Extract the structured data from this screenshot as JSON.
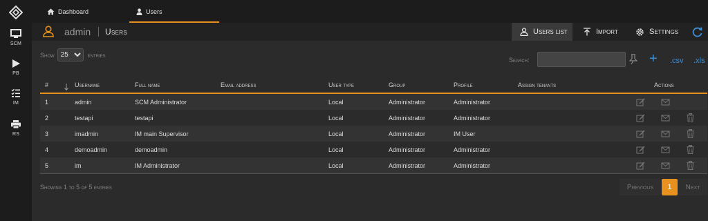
{
  "sidebar": {
    "items": [
      {
        "label": "SCM",
        "icon": "monitor-icon"
      },
      {
        "label": "PB",
        "icon": "play-icon"
      },
      {
        "label": "IM",
        "icon": "list-check-icon"
      },
      {
        "label": "RS",
        "icon": "printer-icon"
      }
    ]
  },
  "tabs": [
    {
      "label": "Dashboard",
      "icon": "home-icon"
    },
    {
      "label": "Users",
      "icon": "user-icon",
      "active": true
    }
  ],
  "header": {
    "username": "admin",
    "title": "Users",
    "buttons": {
      "users_list": "Users list",
      "import": "Import",
      "settings": "Settings"
    }
  },
  "controls": {
    "show_label": "Show",
    "show_value": "25",
    "entries_label": "entries",
    "search_label": "Search:",
    "search_value": "",
    "add_symbol": "+",
    "csv": ".csv",
    "xls": ".xls"
  },
  "table": {
    "columns": [
      "#",
      "Username",
      "Full name",
      "Email address",
      "User type",
      "Group",
      "Profile",
      "Assign tenants",
      "Actions"
    ],
    "rows": [
      {
        "num": "1",
        "username": "admin",
        "fullname": "SCM Administrator",
        "email": "",
        "type": "Local",
        "group": "Administrator",
        "profile": "Administrator",
        "tenants": "",
        "deletable": false
      },
      {
        "num": "2",
        "username": "testapi",
        "fullname": "testapi",
        "email": "",
        "type": "Local",
        "group": "Administrator",
        "profile": "Administrator",
        "tenants": "",
        "deletable": true
      },
      {
        "num": "3",
        "username": "imadmin",
        "fullname": "IM main Supervisor",
        "email": "",
        "type": "Local",
        "group": "Administrator",
        "profile": "IM User",
        "tenants": "",
        "deletable": true
      },
      {
        "num": "4",
        "username": "demoadmin",
        "fullname": "demoadmin",
        "email": "",
        "type": "Local",
        "group": "Administrator",
        "profile": "Administrator",
        "tenants": "",
        "deletable": true
      },
      {
        "num": "5",
        "username": "im",
        "fullname": "IM Administrator",
        "email": "",
        "type": "Local",
        "group": "Administrator",
        "profile": "Administrator",
        "tenants": "",
        "deletable": true
      }
    ]
  },
  "footer": {
    "info": "Showing 1 to 5 of 5 entries",
    "previous": "Previous",
    "current_page": "1",
    "next": "Next"
  },
  "colors": {
    "accent": "#e8911f",
    "link": "#3d8fd9"
  }
}
